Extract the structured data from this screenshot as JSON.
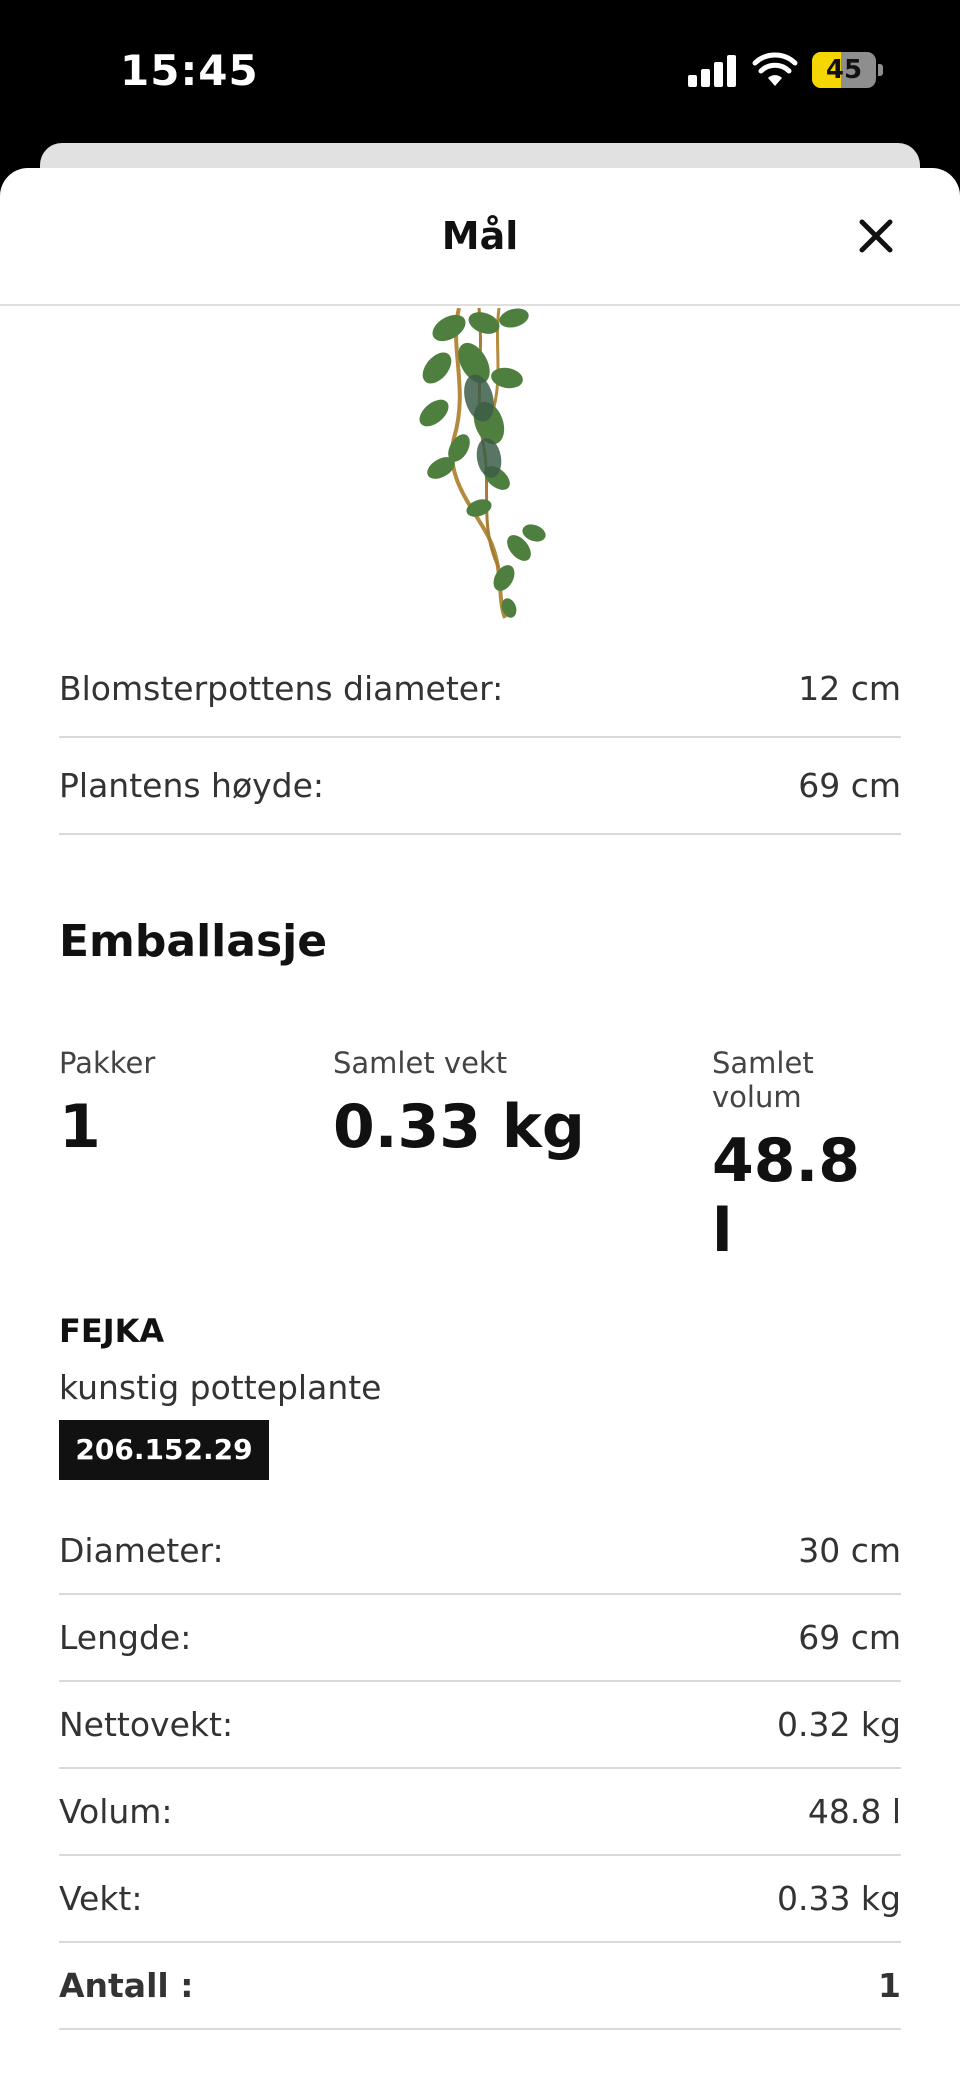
{
  "status_bar": {
    "time": "15:45",
    "battery_level": "45",
    "icons": [
      "cellular-signal-icon",
      "wifi-icon",
      "battery-icon"
    ]
  },
  "sheet": {
    "title": "Mål",
    "close_icon": "close-icon"
  },
  "product_image": "artificial-ivy-plant-image",
  "dimensions": [
    {
      "label": "Blomsterpottens diameter:",
      "value": "12 cm"
    },
    {
      "label": "Plantens høyde:",
      "value": "69 cm"
    }
  ],
  "packaging": {
    "title": "Emballasje",
    "stats": [
      {
        "caption": "Pakker",
        "value": "1"
      },
      {
        "caption": "Samlet vekt",
        "value": "0.33 kg"
      },
      {
        "caption": "Samlet volum",
        "value": "48.8 l"
      }
    ],
    "product": {
      "name": "FEJKA",
      "description": "kunstig potteplante",
      "article_number": "206.152.29"
    },
    "specs": [
      {
        "label": "Diameter:",
        "value": "30 cm"
      },
      {
        "label": "Lengde:",
        "value": "69 cm"
      },
      {
        "label": "Nettovekt:",
        "value": "0.32 kg"
      },
      {
        "label": "Volum:",
        "value": "48.8 l"
      },
      {
        "label": "Vekt:",
        "value": "0.33 kg"
      },
      {
        "label": "Antall :",
        "value": "1"
      }
    ]
  },
  "colors": {
    "background": "#ffffff",
    "text": "#111111",
    "divider": "#dadada",
    "article_badge": "#111111",
    "battery": "#f5d600"
  }
}
